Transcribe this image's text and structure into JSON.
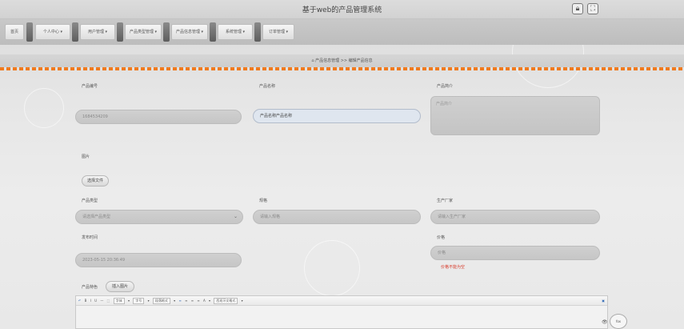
{
  "app": {
    "title": "基于web的产品管理系统",
    "icons": [
      "lock-icon",
      "fullscreen-icon"
    ]
  },
  "nav": {
    "items": [
      {
        "label": "首页"
      },
      {
        "label": "个人中心 ▾"
      },
      {
        "label": "用户管理 ▾"
      },
      {
        "label": "产品类型管理 ▾"
      },
      {
        "label": "产品信息管理 ▾"
      },
      {
        "label": "系统管理 ▾"
      },
      {
        "label": "订单管理 ▾"
      }
    ]
  },
  "breadcrumb": {
    "icon": "⌂",
    "text": "产品信息管理 >> 编辑产品信息"
  },
  "form": {
    "product_no": {
      "label": "产品编号",
      "value": "1684534209"
    },
    "product_name": {
      "label": "产品名称",
      "value": "产品名称产品名称"
    },
    "product_intro": {
      "label": "产品简介",
      "placeholder": "产品简介"
    },
    "image": {
      "label": "图片",
      "button": "选择文件"
    },
    "product_type": {
      "label": "产品类型",
      "value": "请选择产品类型"
    },
    "spec": {
      "label": "规格",
      "placeholder": "请输入规格"
    },
    "manufacturer": {
      "label": "生产厂家",
      "placeholder": "请输入生产厂家"
    },
    "publish_time": {
      "label": "发布时间",
      "value": "2023-05-15 20:36:49"
    },
    "price": {
      "label": "价格",
      "placeholder": "价格",
      "error": "价格不能为空"
    },
    "features": {
      "label": "产品特色",
      "button": "插入图片"
    }
  },
  "editor": {
    "toolbar": [
      "↶",
      "B",
      "I",
      "U",
      "—",
      "⬚",
      "字体",
      "▾",
      "字号",
      "▾",
      "段落格式",
      "▾",
      "≡",
      "≡",
      "≡",
      "≡",
      "A",
      "▾",
      "西班牙文格式",
      "▾"
    ],
    "end": "▣"
  },
  "widget": {
    "label": "fox"
  },
  "colors": {
    "accent": "#f07a1e",
    "error": "#d83a2a",
    "focus": "#dfe6ef"
  }
}
